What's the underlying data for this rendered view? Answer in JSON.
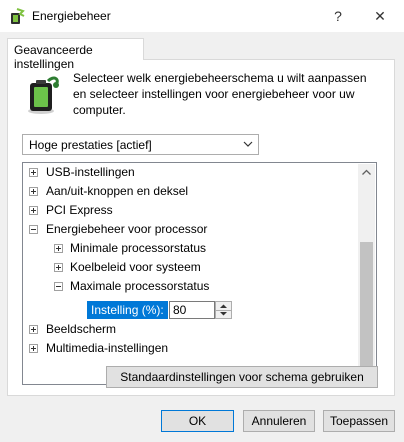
{
  "window": {
    "title": "Energiebeheer",
    "help_glyph": "?",
    "close_glyph": "✕"
  },
  "tab": {
    "label": "Geavanceerde instellingen"
  },
  "description": "Selecteer welk energiebeheerschema u wilt aanpassen en selecteer instellingen voor energiebeheer voor uw computer.",
  "scheme": {
    "selected": "Hoge prestaties [actief]"
  },
  "tree": {
    "items": [
      {
        "label": "USB-instellingen",
        "state": "collapsed",
        "level": 0
      },
      {
        "label": "Aan/uit-knoppen en deksel",
        "state": "collapsed",
        "level": 0
      },
      {
        "label": "PCI Express",
        "state": "collapsed",
        "level": 0
      },
      {
        "label": "Energiebeheer voor processor",
        "state": "expanded",
        "level": 0
      },
      {
        "label": "Minimale processorstatus",
        "state": "collapsed",
        "level": 1
      },
      {
        "label": "Koelbeleid voor systeem",
        "state": "collapsed",
        "level": 1
      },
      {
        "label": "Maximale processorstatus",
        "state": "expanded",
        "level": 1
      },
      {
        "label": "Beeldscherm",
        "state": "collapsed",
        "level": 0
      },
      {
        "label": "Multimedia-instellingen",
        "state": "collapsed",
        "level": 0
      }
    ],
    "setting": {
      "label": "Instelling (%):",
      "value": "80"
    }
  },
  "buttons": {
    "restore": "Standaardinstellingen voor schema gebruiken",
    "ok": "OK",
    "cancel": "Annuleren",
    "apply": "Toepassen"
  },
  "colors": {
    "selection": "#0078d7",
    "dialog_bg": "#f0f0f0"
  }
}
